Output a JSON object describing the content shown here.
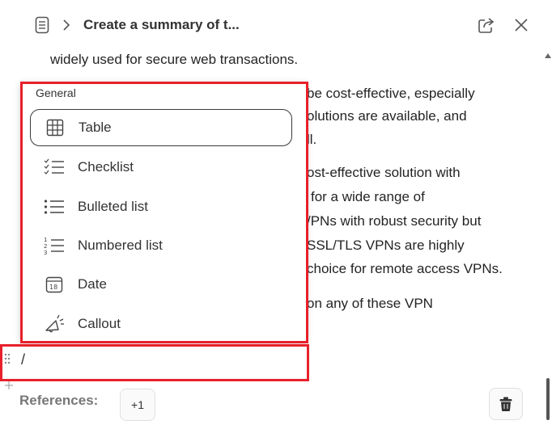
{
  "header": {
    "title": "Create a summary of t...",
    "page_icon": "page-icon",
    "chevron_icon": "chevron-right-icon",
    "share_icon": "share-icon",
    "close_icon": "close-icon"
  },
  "content": {
    "line_top": "widely used for secure web transactions.",
    "lines_right": [
      "be cost-effective, especially",
      "olutions are available, and",
      "ll.",
      "ost-effective solution with",
      "for a wide range of",
      "/PNs with robust security but",
      "SSL/TLS VPNs are highly",
      "choice for remote access VPNs.",
      "on any of these VPN"
    ]
  },
  "menu": {
    "header": "General",
    "items": [
      {
        "label": "Table",
        "icon": "table-icon"
      },
      {
        "label": "Checklist",
        "icon": "checklist-icon"
      },
      {
        "label": "Bulleted list",
        "icon": "bulleted-list-icon"
      },
      {
        "label": "Numbered list",
        "icon": "numbered-list-icon"
      },
      {
        "label": "Date",
        "icon": "calendar-icon"
      },
      {
        "label": "Callout",
        "icon": "megaphone-icon"
      }
    ]
  },
  "input": {
    "value": "/"
  },
  "footer": {
    "references_label": "References:",
    "references_more": "+1",
    "delete_icon": "trash-icon"
  },
  "colors": {
    "highlight": "#e8202a",
    "text": "#242424"
  }
}
